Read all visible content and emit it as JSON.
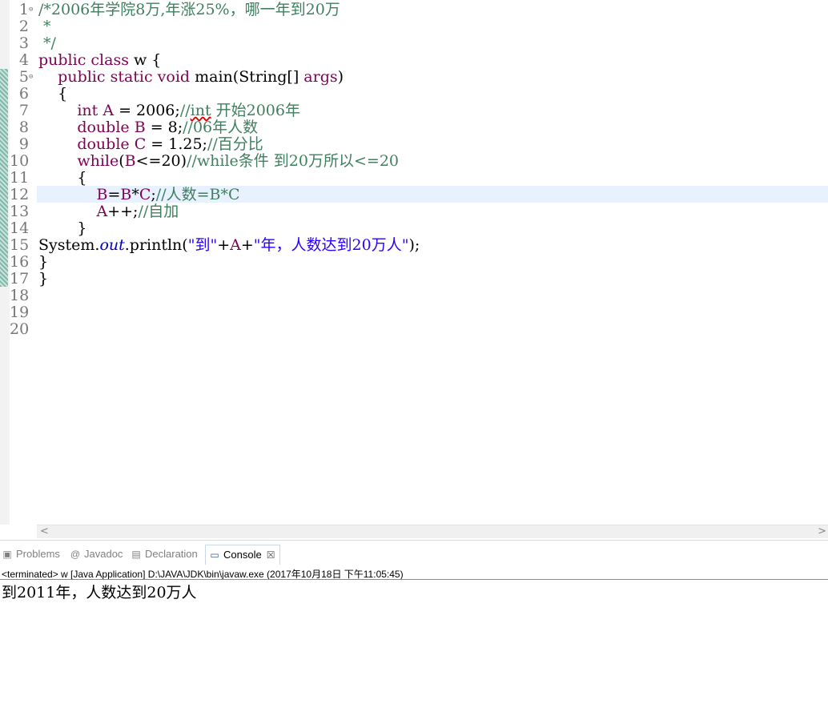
{
  "editor": {
    "lines": [
      {
        "n": "1",
        "fold": "⊖",
        "parts": [
          {
            "t": "/*2006年学院8万,年涨25%，哪一年到20万",
            "c": "cm"
          }
        ]
      },
      {
        "n": "2",
        "parts": [
          {
            "t": " *",
            "c": "cm"
          }
        ]
      },
      {
        "n": "3",
        "parts": [
          {
            "t": " */",
            "c": "cm"
          }
        ]
      },
      {
        "n": "4",
        "parts": [
          {
            "t": "public class",
            "c": "kw"
          },
          {
            "t": " w {",
            "c": ""
          }
        ]
      },
      {
        "n": "5",
        "fold": "⊖",
        "parts": [
          {
            "t": "    ",
            "c": ""
          },
          {
            "t": "public static void",
            "c": "kw"
          },
          {
            "t": " main(String[] ",
            "c": ""
          },
          {
            "t": "args",
            "c": "kw"
          },
          {
            "t": ")",
            "c": ""
          }
        ]
      },
      {
        "n": "6",
        "parts": [
          {
            "t": "    {",
            "c": ""
          }
        ]
      },
      {
        "n": "7",
        "parts": [
          {
            "t": "        ",
            "c": ""
          },
          {
            "t": "int",
            "c": "kw"
          },
          {
            "t": " A",
            "c": "kw"
          },
          {
            "t": " = 2006;",
            "c": ""
          },
          {
            "t": "//",
            "c": "cm"
          },
          {
            "t": "int",
            "c": "cm sq"
          },
          {
            "t": " 开始2006年",
            "c": "cm"
          }
        ]
      },
      {
        "n": "8",
        "parts": [
          {
            "t": "        ",
            "c": ""
          },
          {
            "t": "double B",
            "c": "kw"
          },
          {
            "t": " = 8;",
            "c": ""
          },
          {
            "t": "//06年人数",
            "c": "cm"
          }
        ]
      },
      {
        "n": "9",
        "parts": [
          {
            "t": "        ",
            "c": ""
          },
          {
            "t": "double C",
            "c": "kw"
          },
          {
            "t": " = 1.25;",
            "c": ""
          },
          {
            "t": "//百分比",
            "c": "cm"
          }
        ]
      },
      {
        "n": "10",
        "parts": [
          {
            "t": "        ",
            "c": ""
          },
          {
            "t": "while",
            "c": "kw"
          },
          {
            "t": "(",
            "c": ""
          },
          {
            "t": "B",
            "c": "kw"
          },
          {
            "t": "<=20)",
            "c": ""
          },
          {
            "t": "//while条件 到20万所以<=20",
            "c": "cm"
          }
        ]
      },
      {
        "n": "11",
        "parts": [
          {
            "t": "        {",
            "c": ""
          }
        ]
      },
      {
        "n": "12",
        "parts": [
          {
            "t": "            ",
            "c": ""
          },
          {
            "t": "B",
            "c": "kw"
          },
          {
            "t": "=",
            "c": ""
          },
          {
            "t": "B",
            "c": "kw"
          },
          {
            "t": "*",
            "c": ""
          },
          {
            "t": "C",
            "c": "kw"
          },
          {
            "t": ";",
            "c": ""
          },
          {
            "t": "//人数=B*C",
            "c": "cm"
          }
        ]
      },
      {
        "n": "13",
        "parts": [
          {
            "t": "            ",
            "c": ""
          },
          {
            "t": "A",
            "c": "kw"
          },
          {
            "t": "++;",
            "c": ""
          },
          {
            "t": "//自加",
            "c": "cm"
          }
        ]
      },
      {
        "n": "14",
        "parts": [
          {
            "t": "        }",
            "c": ""
          }
        ]
      },
      {
        "n": "15",
        "parts": [
          {
            "t": "System.",
            "c": ""
          },
          {
            "t": "out",
            "c": "fld"
          },
          {
            "t": ".println(",
            "c": ""
          },
          {
            "t": "\"到\"",
            "c": "str"
          },
          {
            "t": "+",
            "c": ""
          },
          {
            "t": "A",
            "c": "kw"
          },
          {
            "t": "+",
            "c": ""
          },
          {
            "t": "\"年，人数达到20万人\"",
            "c": "str"
          },
          {
            "t": ");",
            "c": ""
          }
        ]
      },
      {
        "n": "16",
        "parts": [
          {
            "t": "}",
            "c": ""
          }
        ]
      },
      {
        "n": "17",
        "parts": [
          {
            "t": "}",
            "c": ""
          }
        ]
      },
      {
        "n": "18",
        "parts": []
      },
      {
        "n": "19",
        "parts": []
      },
      {
        "n": "20",
        "parts": []
      }
    ]
  },
  "scroll": {
    "left": "<",
    "right": ">"
  },
  "tabs": [
    {
      "label": "Problems",
      "icon": "problems-icon",
      "glyph": "▣",
      "active": false
    },
    {
      "label": "Javadoc",
      "icon": "javadoc-icon",
      "glyph": "@",
      "active": false
    },
    {
      "label": "Declaration",
      "icon": "declaration-icon",
      "glyph": "▤",
      "active": false
    },
    {
      "label": "Console",
      "icon": "console-icon",
      "glyph": "▭",
      "active": true,
      "close": "☒"
    }
  ],
  "console": {
    "status": "<terminated> w [Java Application] D:\\JAVA\\JDK\\bin\\javaw.exe (2017年10月18日 下午11:05:45)",
    "output": "到2011年，人数达到20万人"
  },
  "colors": {
    "keyword": "#7f0055",
    "comment": "#3f7f5f",
    "string": "#2a00ff",
    "field": "#0000c0",
    "current_line": "#e8f2fe"
  }
}
